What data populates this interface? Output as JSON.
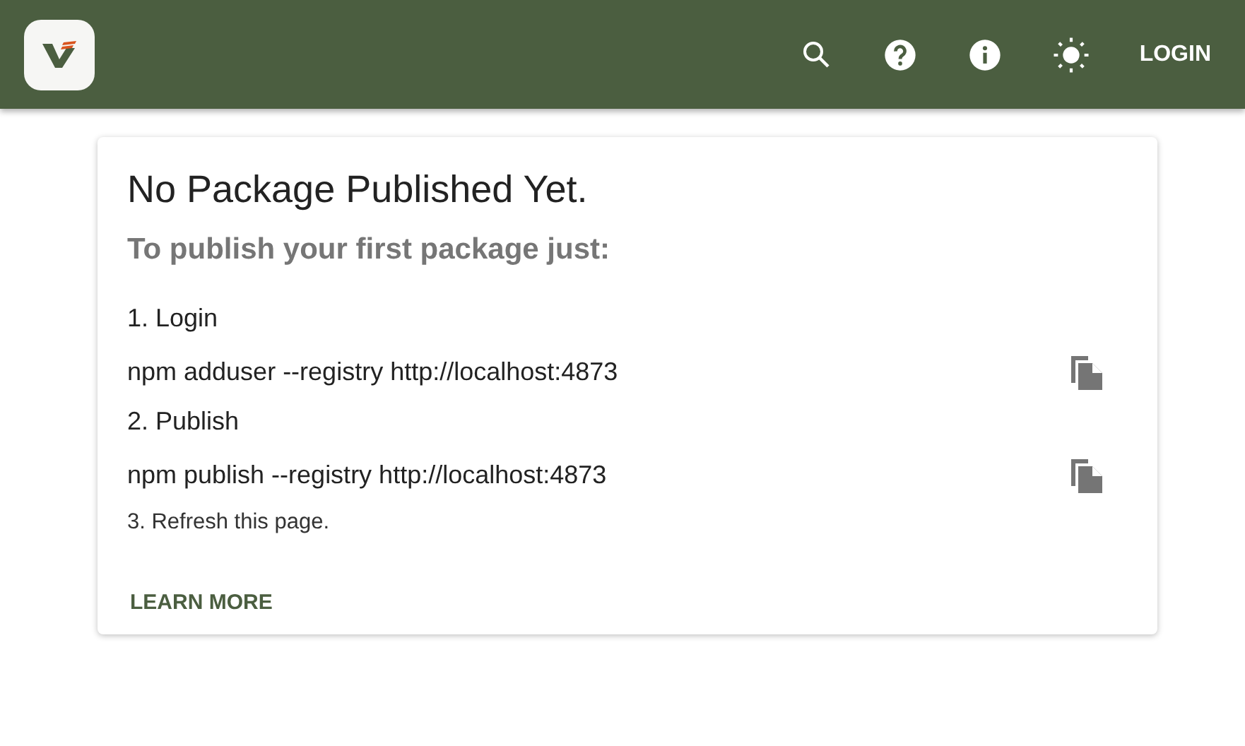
{
  "header": {
    "login_label": "LOGIN"
  },
  "card": {
    "title": "No Package Published Yet.",
    "subtitle": "To publish your first package just:",
    "steps": [
      {
        "kind": "step",
        "text": "1. Login"
      },
      {
        "kind": "command",
        "text": "npm adduser --registry http://localhost:4873"
      },
      {
        "kind": "step",
        "text": "2. Publish"
      },
      {
        "kind": "command",
        "text": "npm publish --registry http://localhost:4873"
      },
      {
        "kind": "note",
        "text": "3. Refresh this page."
      }
    ],
    "learn_more": "LEARN MORE"
  }
}
